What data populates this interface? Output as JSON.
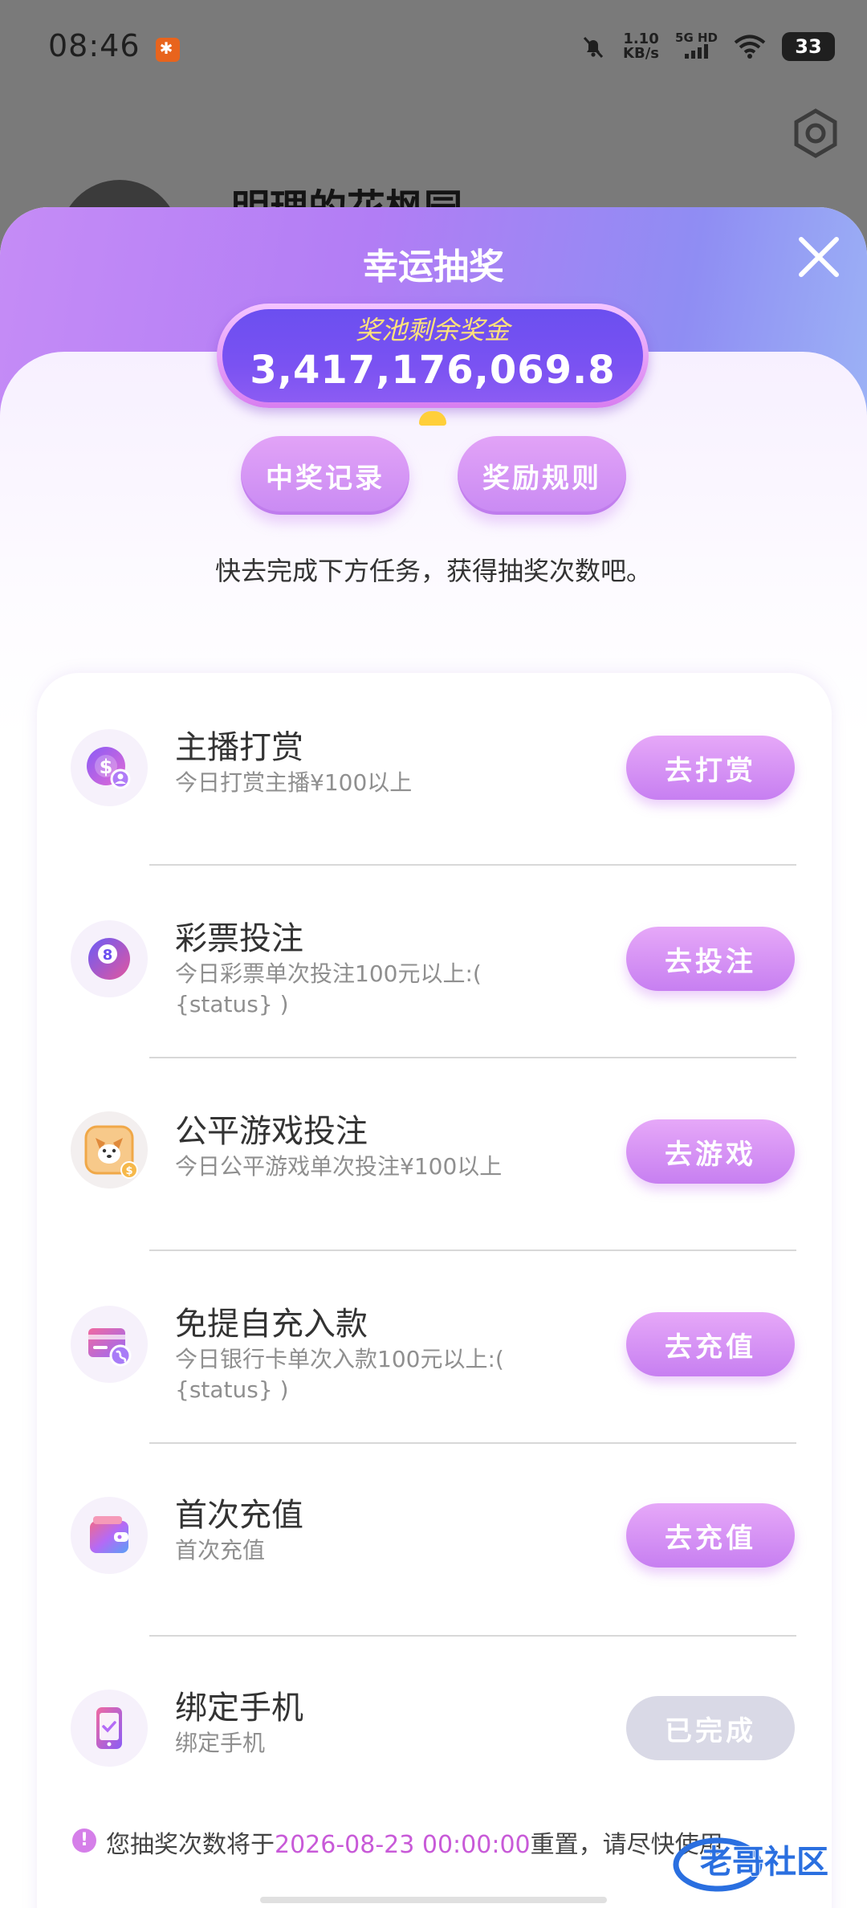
{
  "status_bar": {
    "time": "08:46",
    "net_speed_value": "1.10",
    "net_speed_unit": "KB/s",
    "signal_label": "5G HD",
    "battery": "33"
  },
  "background_page": {
    "user_name": "明理的花枫园"
  },
  "modal": {
    "title": "幸运抽奖",
    "pool_label": "奖池剩余奖金",
    "pool_amount": "3,417,176,069.8",
    "records_button": "中奖记录",
    "rules_button": "奖励规则",
    "hint": "快去完成下方任务，获得抽奖次数吧。"
  },
  "tasks": [
    {
      "title": "主播打赏",
      "desc": "今日打赏主播¥100以上",
      "button": "去打赏",
      "icon": "chip-dollar-icon"
    },
    {
      "title": "彩票投注",
      "desc": "今日彩票单次投注100元以上:( {status} )",
      "button": "去投注",
      "icon": "eight-ball-icon"
    },
    {
      "title": "公平游戏投注",
      "desc": "今日公平游戏单次投注¥100以上",
      "button": "去游戏",
      "icon": "corgi-game-icon"
    },
    {
      "title": "免提自充入款",
      "desc": "今日银行卡单次入款100元以上:( {status} )",
      "button": "去充值",
      "icon": "bank-card-icon"
    },
    {
      "title": "首次充值",
      "desc": "首次充值",
      "button": "去充值",
      "icon": "wallet-icon"
    },
    {
      "title": "绑定手机",
      "desc": "绑定手机",
      "button": "已完成",
      "icon": "phone-check-icon"
    }
  ],
  "footer": {
    "prefix": "您抽奖次数将于",
    "date": "2026-08-23 00:00:00",
    "suffix": "重置，请尽快使用"
  },
  "watermark": "老哥社区",
  "colors": {
    "accent_purple": "#c77ff1",
    "pool_bg": "#6b4ff0",
    "pool_label": "#ffe27a",
    "date_text": "#c85ad8"
  }
}
